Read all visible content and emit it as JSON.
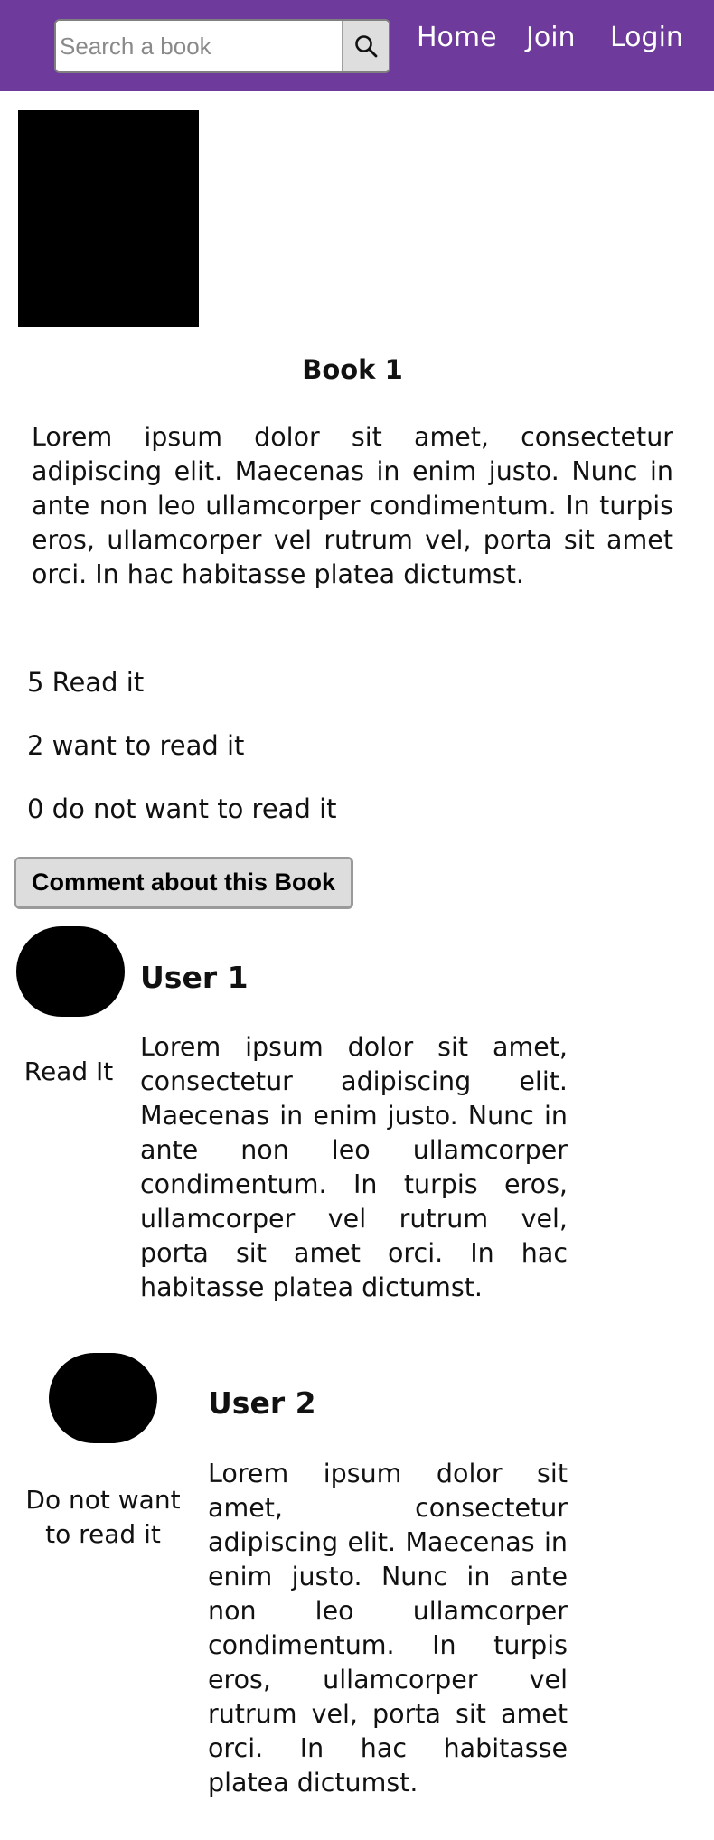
{
  "header": {
    "search": {
      "placeholder": "Search a book",
      "value": "",
      "button_icon": "search-icon"
    },
    "nav": [
      {
        "label": "Home"
      },
      {
        "label": "Join"
      },
      {
        "label": "Login"
      }
    ],
    "background_color": "#6e3a9b"
  },
  "book": {
    "title": "Book 1",
    "description": "Lorem ipsum dolor sit amet, consectetur adipiscing elit. Maecenas in enim justo. Nunc in ante non leo ullamcorper condimentum. In turpis eros, ullamcorper vel rutrum vel, porta sit amet orci. In hac habitasse platea dictumst.",
    "stats": {
      "read": "5 Read it",
      "want": "2 want to read it",
      "not_want": "0 do not want to read it"
    },
    "comment_button_label": "Comment about this Book"
  },
  "comments": [
    {
      "user": "User 1",
      "status": "Read It",
      "text": "Lorem ipsum dolor sit amet, consectetur adipiscing elit. Maecenas in enim justo. Nunc in ante non leo ullamcorper condimentum. In turpis eros, ullamcorper vel rutrum vel, porta sit amet orci. In hac habitasse platea dictumst."
    },
    {
      "user": "User 2",
      "status": "Do not want to read it",
      "text": "Lorem ipsum dolor sit amet, consectetur adipiscing elit. Maecenas in enim justo. Nunc in ante non leo ullamcorper condimentum. In turpis eros, ullamcorper vel rutrum vel, porta sit amet orci. In hac habitasse platea dictumst."
    }
  ]
}
